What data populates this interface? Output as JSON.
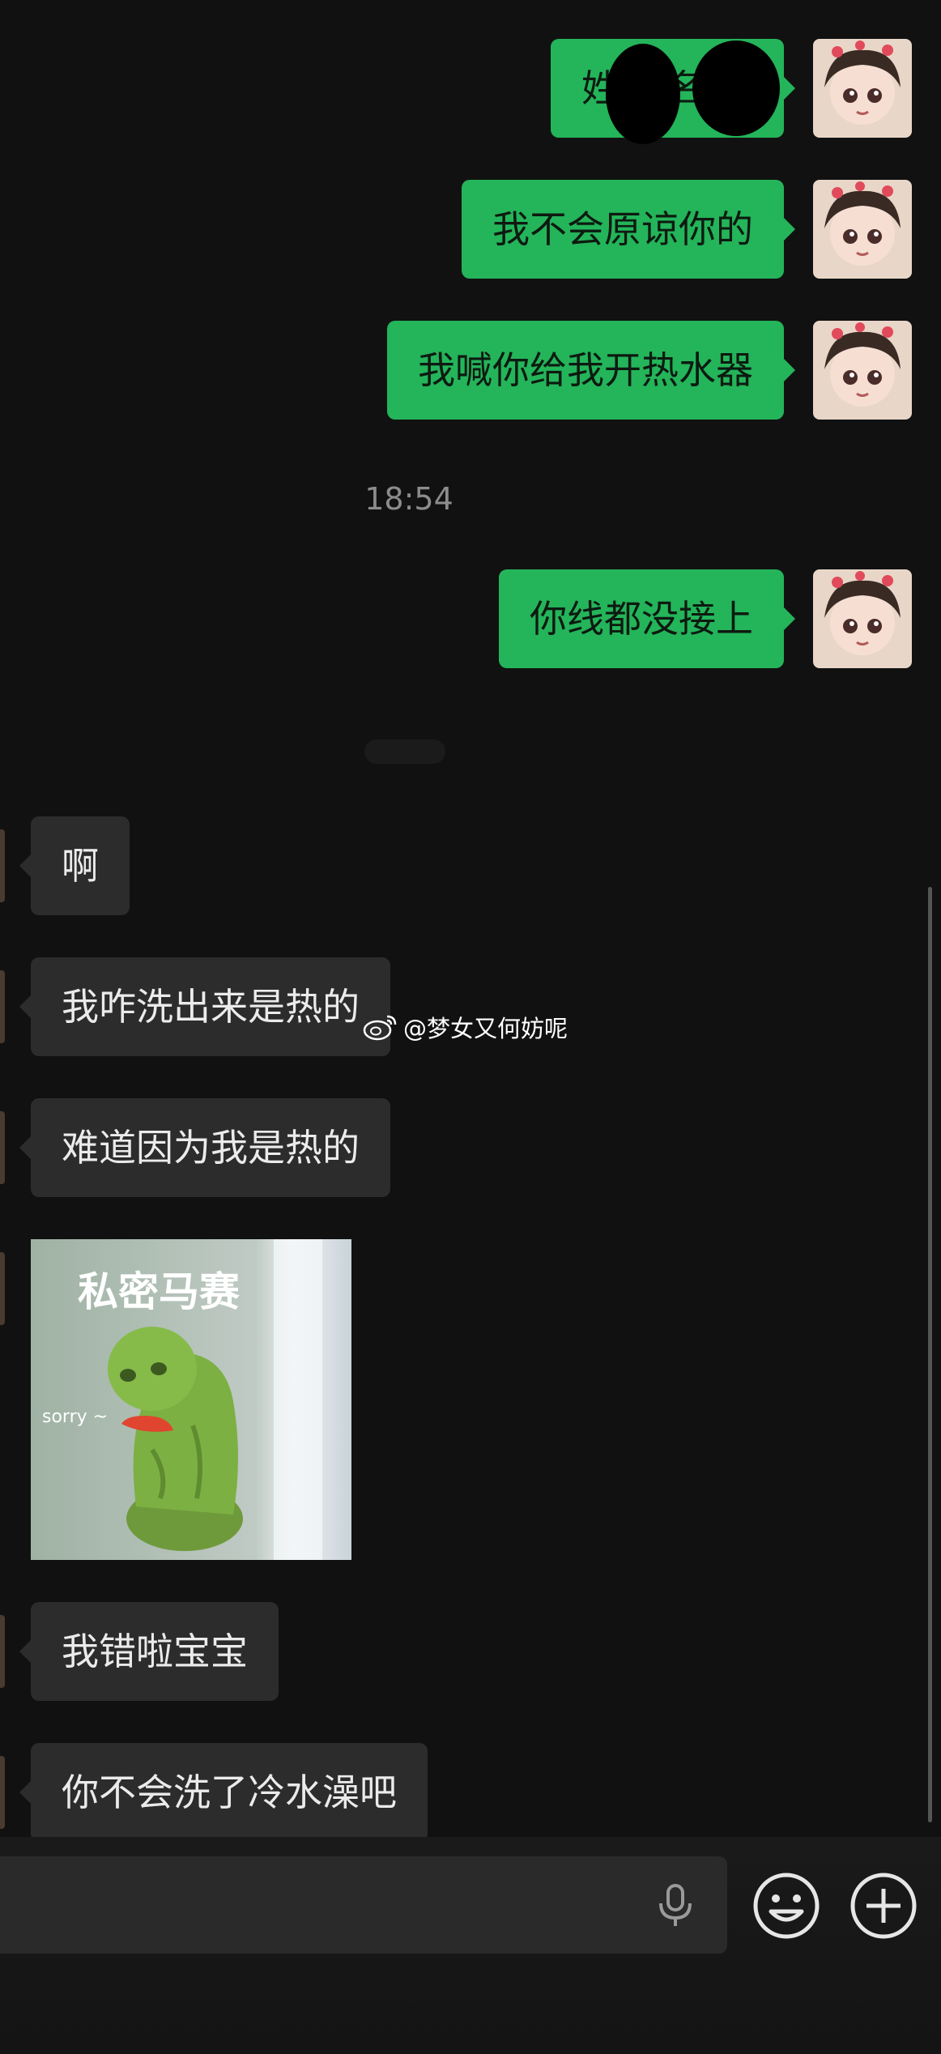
{
  "sent_messages": [
    {
      "text": "姓名"
    },
    {
      "text": "我不会原谅你的"
    },
    {
      "text": "我喊你给我开热水器"
    },
    {
      "text": "你线都没接上"
    }
  ],
  "timestamp": "18:54",
  "received_messages": [
    {
      "text": "啊"
    },
    {
      "text": "我咋洗出来是热的"
    },
    {
      "text": "难道因为我是热的"
    },
    {
      "text": "我错啦宝宝"
    },
    {
      "text": "你不会洗了冷水澡吧"
    }
  ],
  "sticker": {
    "title": "私密马赛",
    "caption": "sorry ~"
  },
  "watermark": "@梦女又何妨呢",
  "colors": {
    "background": "#111111",
    "sent_bubble": "#24b45a",
    "received_bubble": "#2c2c2c"
  },
  "icons": {
    "mic": "mic-icon",
    "emoji": "emoji-icon",
    "plus": "plus-icon",
    "weibo": "weibo-icon"
  }
}
